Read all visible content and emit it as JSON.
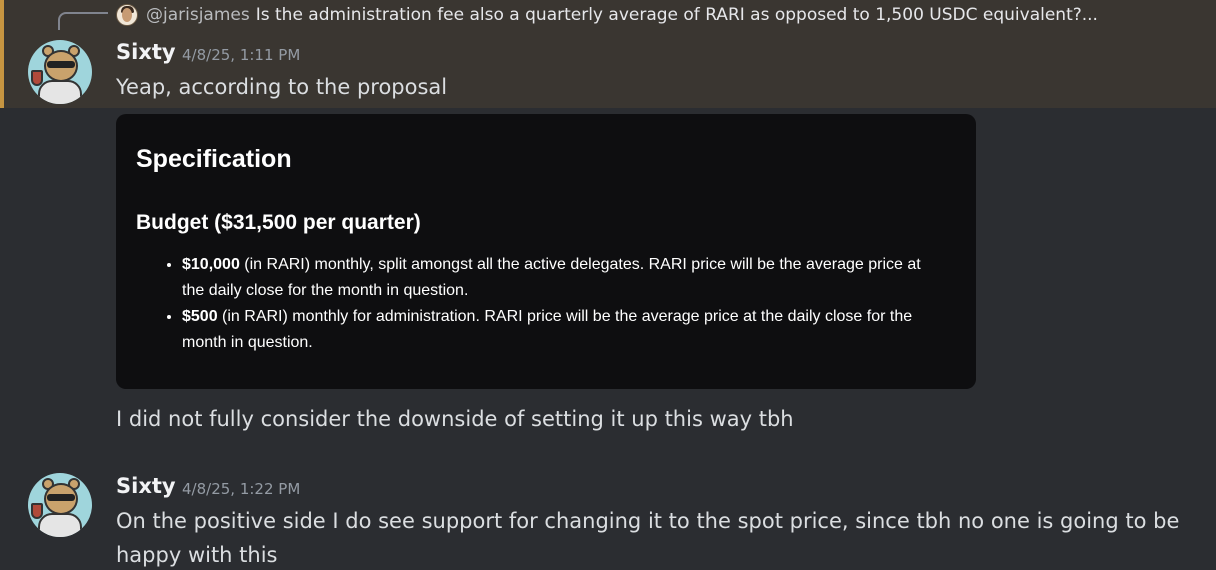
{
  "reply": {
    "mention": "@jarisjames",
    "text": "Is the administration fee also a quarterly average of RARI as opposed to 1,500 USDC equivalent?..."
  },
  "messages": [
    {
      "username": "Sixty",
      "timestamp": "4/8/25, 1:11 PM",
      "text": "Yeap, according to the proposal"
    },
    {
      "text": "I did not fully consider the downside of setting it up this way tbh"
    },
    {
      "username": "Sixty",
      "timestamp": "4/8/25, 1:22 PM",
      "text": "On the positive side I do see support for changing it to the spot price, since tbh no one is going to be happy with this"
    }
  ],
  "embed": {
    "title": "Specification",
    "subtitle": "Budget ($31,500 per quarter)",
    "bullets": [
      {
        "bold": "$10,000",
        "text": " (in RARI) monthly, split amongst all the active delegates. RARI price will be the average price at the daily close for the month in question."
      },
      {
        "bold": "$500",
        "text": " (in RARI) monthly for administration. RARI price will be the average price at the daily close for the month in question."
      }
    ]
  },
  "colors": {
    "highlight_bg": "#3a3631",
    "highlight_border": "#c69541",
    "chat_bg": "#2b2d31",
    "embed_bg": "#0e0e10"
  }
}
